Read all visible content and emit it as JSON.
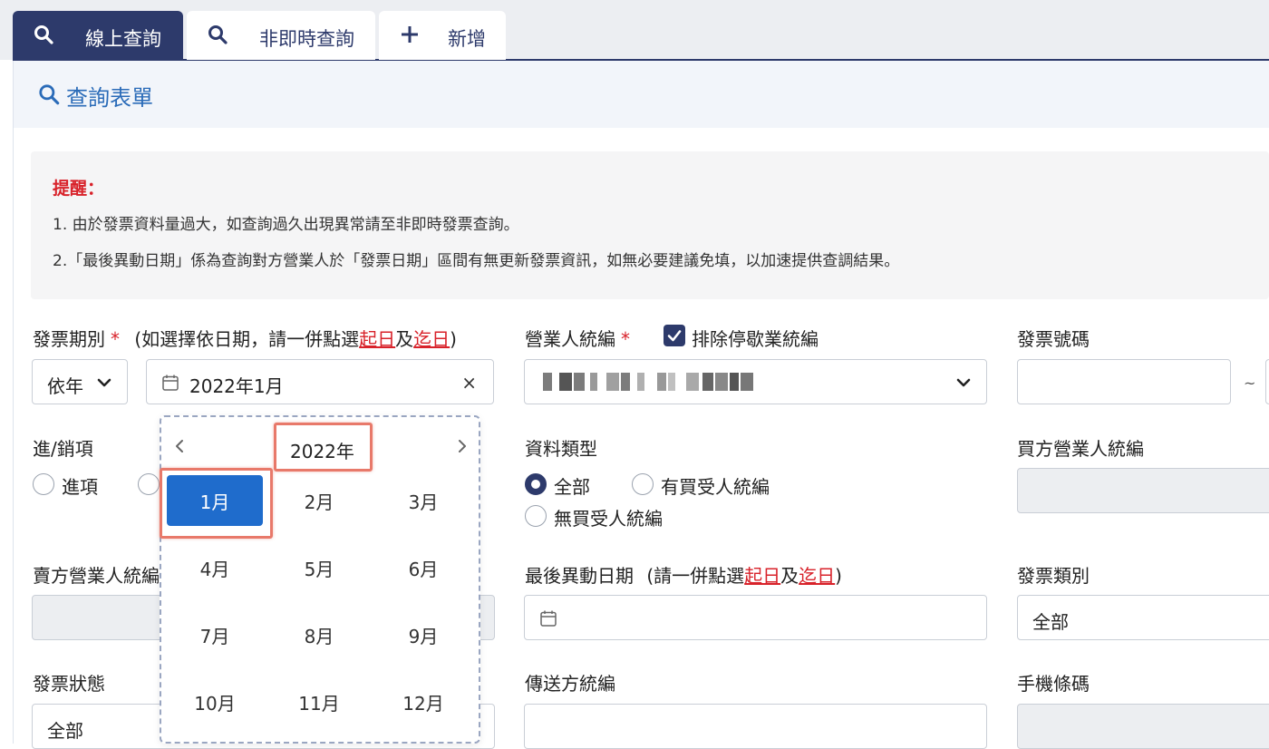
{
  "tabs": [
    {
      "label": "線上查詢",
      "icon": "search-icon",
      "active": true
    },
    {
      "label": "非即時查詢",
      "icon": "search-icon",
      "active": false
    },
    {
      "label": "新增",
      "icon": "plus-icon",
      "active": false
    }
  ],
  "panel": {
    "title": "查詢表單",
    "icon": "search-icon"
  },
  "notice": {
    "title": "提醒：",
    "line1": "1. 由於發票資料量過大，如查詢過久出現異常請至非即時發票查詢。",
    "line2": "2.「最後異動日期」係為查詢對方營業人於「發票日期」區間有無更新發票資訊，如無必要建議免填，以加速提供查調結果。"
  },
  "form": {
    "invoice_period": {
      "label": "發票期別",
      "required": "*",
      "hint_pre": "(如選擇依日期，請一併點選",
      "hint_start": "起日",
      "hint_mid": "及",
      "hint_end": "迄日",
      "hint_post": ")",
      "mode_value": "依年",
      "date_value": "2022年1月",
      "clear": "×"
    },
    "business_id": {
      "label": "營業人統編",
      "required": "*",
      "exclude_label": "排除停歇業統編",
      "exclude_checked": true
    },
    "invoice_number": {
      "label": "發票號碼",
      "separator": "~"
    },
    "io_type": {
      "label": "進/銷項",
      "options": [
        "進項"
      ]
    },
    "data_type": {
      "label": "資料類型",
      "options": [
        "全部",
        "有買受人統編",
        "無買受人統編"
      ],
      "selected": "全部"
    },
    "buyer_id": {
      "label": "買方營業人統編"
    },
    "seller_id": {
      "label": "賣方營業人統編"
    },
    "last_modified": {
      "label": "最後異動日期",
      "hint_pre": "(請一併點選",
      "hint_start": "起日",
      "hint_mid": "及",
      "hint_end": "迄日",
      "hint_post": ")"
    },
    "invoice_category": {
      "label": "發票類別",
      "value": "全部"
    },
    "invoice_status": {
      "label": "發票狀態",
      "value": "全部"
    },
    "sender_id": {
      "label": "傳送方統編"
    },
    "mobile_barcode": {
      "label": "手機條碼"
    }
  },
  "month_picker": {
    "year": "2022年",
    "selected": "1月",
    "months": [
      "1月",
      "2月",
      "3月",
      "4月",
      "5月",
      "6月",
      "7月",
      "8月",
      "9月",
      "10月",
      "11月",
      "12月"
    ]
  },
  "colors": {
    "navy": "#2d3a6b",
    "blue": "#1f6ccc",
    "red": "#d8222a",
    "highlight": "#e8796a"
  }
}
